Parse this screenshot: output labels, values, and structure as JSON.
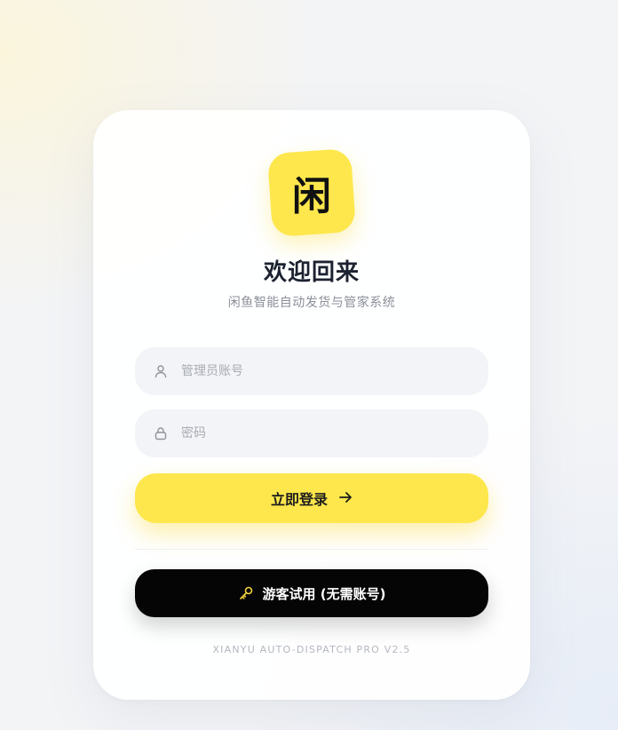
{
  "logo": {
    "char": "闲",
    "color": "#fde74c"
  },
  "title": "欢迎回来",
  "subtitle": "闲鱼智能自动发货与管家系统",
  "username": {
    "placeholder": "管理员账号",
    "value": "",
    "icon": "user-icon"
  },
  "password": {
    "placeholder": "密码",
    "value": "",
    "icon": "lock-icon"
  },
  "login_button": {
    "label": "立即登录",
    "icon": "arrow-right-icon",
    "color": "#fde74c"
  },
  "guest_button": {
    "label": "游客试用 (无需账号)",
    "icon": "key-icon",
    "color": "#050505"
  },
  "footer": "XIANYU AUTO-DISPATCH PRO V2.5"
}
